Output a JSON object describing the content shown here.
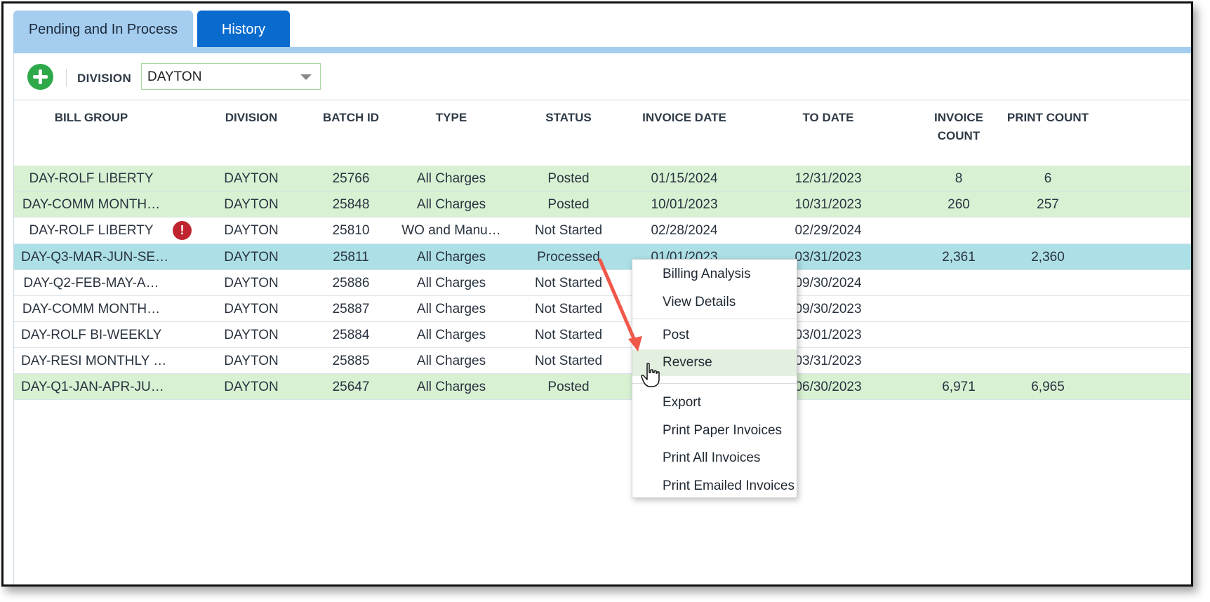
{
  "tabs": [
    {
      "label": "Pending and In Process",
      "active": true
    },
    {
      "label": "History",
      "active": false
    }
  ],
  "toolbar": {
    "add_icon": "plus-circle-icon",
    "division_label": "DIVISION",
    "division_value": "DAYTON"
  },
  "columns": {
    "bill_group": "BILL GROUP",
    "division": "DIVISION",
    "batch_id": "BATCH ID",
    "type": "TYPE",
    "status": "STATUS",
    "invoice_date": "INVOICE DATE",
    "to_date": "TO DATE",
    "invoice_count_1": "INVOICE",
    "invoice_count_2": "COUNT",
    "print_count": "PRINT COUNT"
  },
  "rows": [
    {
      "bill_group": "DAY-ROLF LIBERTY",
      "division": "DAYTON",
      "batch_id": "25766",
      "type": "All Charges",
      "status": "Posted",
      "invoice_date": "01/15/2024",
      "to_date": "12/31/2023",
      "invoice_count": "8",
      "print_count": "6"
    },
    {
      "bill_group": "DAY-COMM MONTH…",
      "division": "DAYTON",
      "batch_id": "25848",
      "type": "All Charges",
      "status": "Posted",
      "invoice_date": "10/01/2023",
      "to_date": "10/31/2023",
      "invoice_count": "260",
      "print_count": "257"
    },
    {
      "bill_group": "DAY-ROLF LIBERTY",
      "division": "DAYTON",
      "batch_id": "25810",
      "type": "WO and Manu…",
      "status": "Not Started",
      "invoice_date": "02/28/2024",
      "to_date": "02/29/2024",
      "invoice_count": "",
      "print_count": "",
      "warning_icon": "!"
    },
    {
      "bill_group": "DAY-Q3-MAR-JUN-SE…",
      "division": "DAYTON",
      "batch_id": "25811",
      "type": "All Charges",
      "status": "Processed",
      "invoice_date": "01/01/2023",
      "to_date": "03/31/2023",
      "invoice_count": "2,361",
      "print_count": "2,360"
    },
    {
      "bill_group": "DAY-Q2-FEB-MAY-A…",
      "division": "DAYTON",
      "batch_id": "25886",
      "type": "All Charges",
      "status": "Not Started",
      "invoice_date": "",
      "to_date": "09/30/2024",
      "invoice_count": "",
      "print_count": ""
    },
    {
      "bill_group": "DAY-COMM MONTH…",
      "division": "DAYTON",
      "batch_id": "25887",
      "type": "All Charges",
      "status": "Not Started",
      "invoice_date": "",
      "to_date": "09/30/2023",
      "invoice_count": "",
      "print_count": ""
    },
    {
      "bill_group": "DAY-ROLF BI-WEEKLY",
      "division": "DAYTON",
      "batch_id": "25884",
      "type": "All Charges",
      "status": "Not Started",
      "invoice_date": "",
      "to_date": "03/01/2023",
      "invoice_count": "",
      "print_count": ""
    },
    {
      "bill_group": "DAY-RESI MONTHLY …",
      "division": "DAYTON",
      "batch_id": "25885",
      "type": "All Charges",
      "status": "Not Started",
      "invoice_date": "",
      "to_date": "03/31/2023",
      "invoice_count": "",
      "print_count": ""
    },
    {
      "bill_group": "DAY-Q1-JAN-APR-JU…",
      "division": "DAYTON",
      "batch_id": "25647",
      "type": "All Charges",
      "status": "Posted",
      "invoice_date": "",
      "to_date": "06/30/2023",
      "invoice_count": "6,971",
      "print_count": "6,965"
    }
  ],
  "context_menu": {
    "items": [
      "Billing Analysis",
      "View Details",
      "Post",
      "Reverse",
      "Export",
      "Print Paper Invoices",
      "Print All Invoices",
      "Print Emailed Invoices"
    ],
    "hovered": "Reverse"
  },
  "colors": {
    "tab_active": "#a5cdf0",
    "tab_inactive": "#0a6bcf",
    "row_posted": "#d8f1d3",
    "row_selected": "#acdfe6",
    "add_button": "#2ea94a",
    "warning": "#c0242e",
    "annotation_arrow": "#f0584a"
  }
}
